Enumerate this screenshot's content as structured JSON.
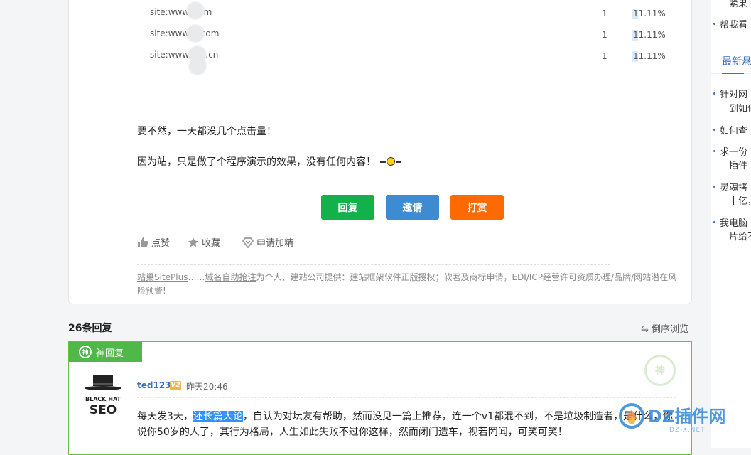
{
  "stats": [
    {
      "site": "site:www.      com",
      "count": "1",
      "percent": "11.11%"
    },
    {
      "site": "site:www.      s.com",
      "count": "1",
      "percent": "11.11%"
    },
    {
      "site": "site:www.t      rk.cn",
      "count": "1",
      "percent": "11.11%"
    }
  ],
  "post": {
    "line1": "要不然，一天都没几个点击量！",
    "line2": "因为站，只是做了个程序演示的效果，没有任何内容！"
  },
  "buttons": {
    "reply": "回复",
    "invite": "邀请",
    "tip": "打赏"
  },
  "actions": {
    "like": "点赞",
    "favorite": "收藏",
    "apply_featured": "申请加精"
  },
  "footnote": {
    "link1": "站巢SitePlus",
    "sep": "……",
    "link2": "域名自助抢注",
    "rest": "为个人、建站公司提供：建站框架软件正版授权；软著及商标申请，EDI/ICP经营许可资质办理/品牌/网站潜在风险预警!"
  },
  "replies": {
    "count_label": "26条回复",
    "reverse_label": "倒序浏览"
  },
  "reply": {
    "badge": "神回复",
    "avatar_line1": "BLACK HAT",
    "avatar_line2": "SEO",
    "username": "ted123",
    "level": "V2",
    "time": "昨天20:46",
    "text_before": "每天发3天，",
    "text_highlight": "还长篇大论",
    "text_after": "，自认为对坛友有帮助，然而没见一篇上推荐，连一个v1都混不到，不是垃圾制造者，是什么，你说你50岁的人了，其行为格局，人生如此失败不过你这样，然而闭门造车，视若罔闻，可笑可笑！"
  },
  "sidebar": {
    "top_item_fragment": "紧果",
    "item_help": "帮我看",
    "section_title": "最新悬",
    "items": [
      {
        "line1": "针对网",
        "line2": "到如何"
      },
      {
        "line1": "如何查"
      },
      {
        "line1": "求一份",
        "line2": "插件"
      },
      {
        "line1": "灵魂拷",
        "line2": "十亿，"
      },
      {
        "line1": "我电脑",
        "line2": "片给不"
      }
    ]
  },
  "watermark": {
    "brand": "DZ插件网",
    "domain": "DZ-X.NET"
  },
  "colors": {
    "reply_btn": "#12b14a",
    "invite_btn": "#3d8bd0",
    "tip_btn": "#ff6a00",
    "accent_green": "#4fb848",
    "link_blue": "#3b6fc4"
  }
}
